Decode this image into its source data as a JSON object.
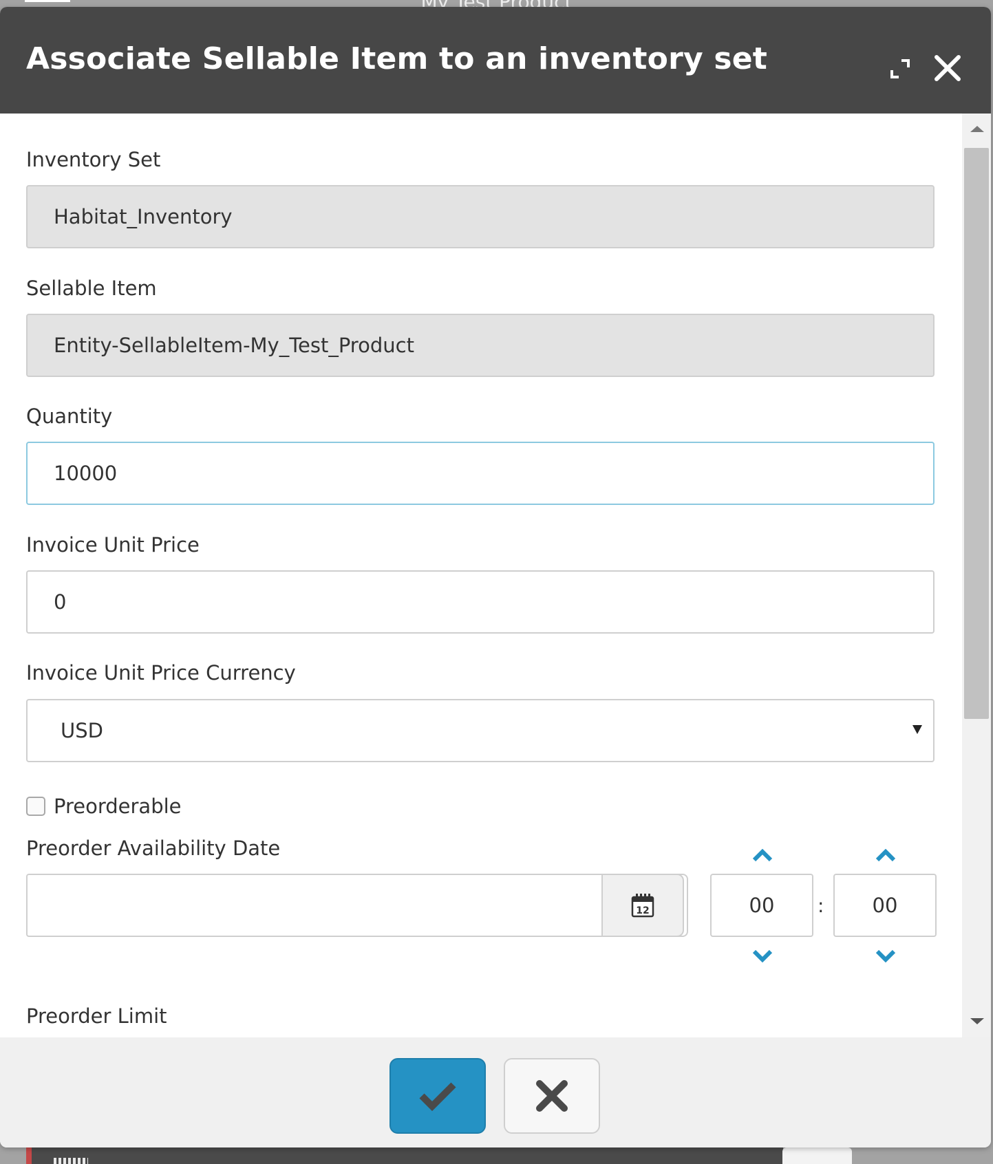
{
  "background": {
    "page_title": "My Test Product"
  },
  "dialog": {
    "title": "Associate Sellable Item to an inventory set",
    "icons": {
      "expand": "expand-icon",
      "close": "close-icon"
    }
  },
  "form": {
    "inventory_set": {
      "label": "Inventory Set",
      "value": "Habitat_Inventory"
    },
    "sellable_item": {
      "label": "Sellable Item",
      "value": "Entity-SellableItem-My_Test_Product"
    },
    "quantity": {
      "label": "Quantity",
      "value": "10000"
    },
    "invoice_unit_price": {
      "label": "Invoice Unit Price",
      "value": "0"
    },
    "invoice_unit_price_currency": {
      "label": "Invoice Unit Price Currency",
      "selected": "USD"
    },
    "preorderable": {
      "label": "Preorderable",
      "checked": false
    },
    "preorder_availability_date": {
      "label": "Preorder Availability Date",
      "date_value": "",
      "hour": "00",
      "minute": "00",
      "separator": ":",
      "calendar_day_number": "12"
    },
    "preorder_limit": {
      "label": "Preorder Limit"
    }
  },
  "footer": {
    "ok_icon": "checkmark-icon",
    "cancel_icon": "x-icon"
  },
  "colors": {
    "header_bg": "#474747",
    "primary_button": "#2592c4",
    "focus_border": "#8cc9e0",
    "chevron": "#2592c4"
  }
}
